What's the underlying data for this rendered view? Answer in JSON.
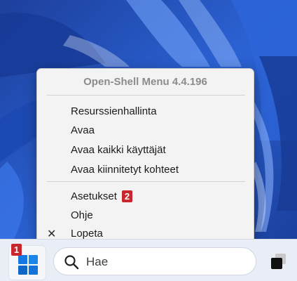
{
  "context_menu": {
    "title": "Open-Shell Menu 4.4.196",
    "items": [
      {
        "label": "Resurssienhallinta"
      },
      {
        "label": "Avaa"
      },
      {
        "label": "Avaa kaikki käyttäjät"
      },
      {
        "label": "Avaa kiinnitetyt kohteet"
      },
      {
        "label": "Asetukset"
      },
      {
        "label": "Ohje"
      },
      {
        "label": "Lopeta",
        "check": "✕"
      }
    ]
  },
  "badges": {
    "start": "1",
    "settings": "2"
  },
  "taskbar": {
    "search_placeholder": "Hae"
  },
  "colors": {
    "accent_badge": "#c8262c",
    "windows_blue": "#0a6cd6"
  }
}
